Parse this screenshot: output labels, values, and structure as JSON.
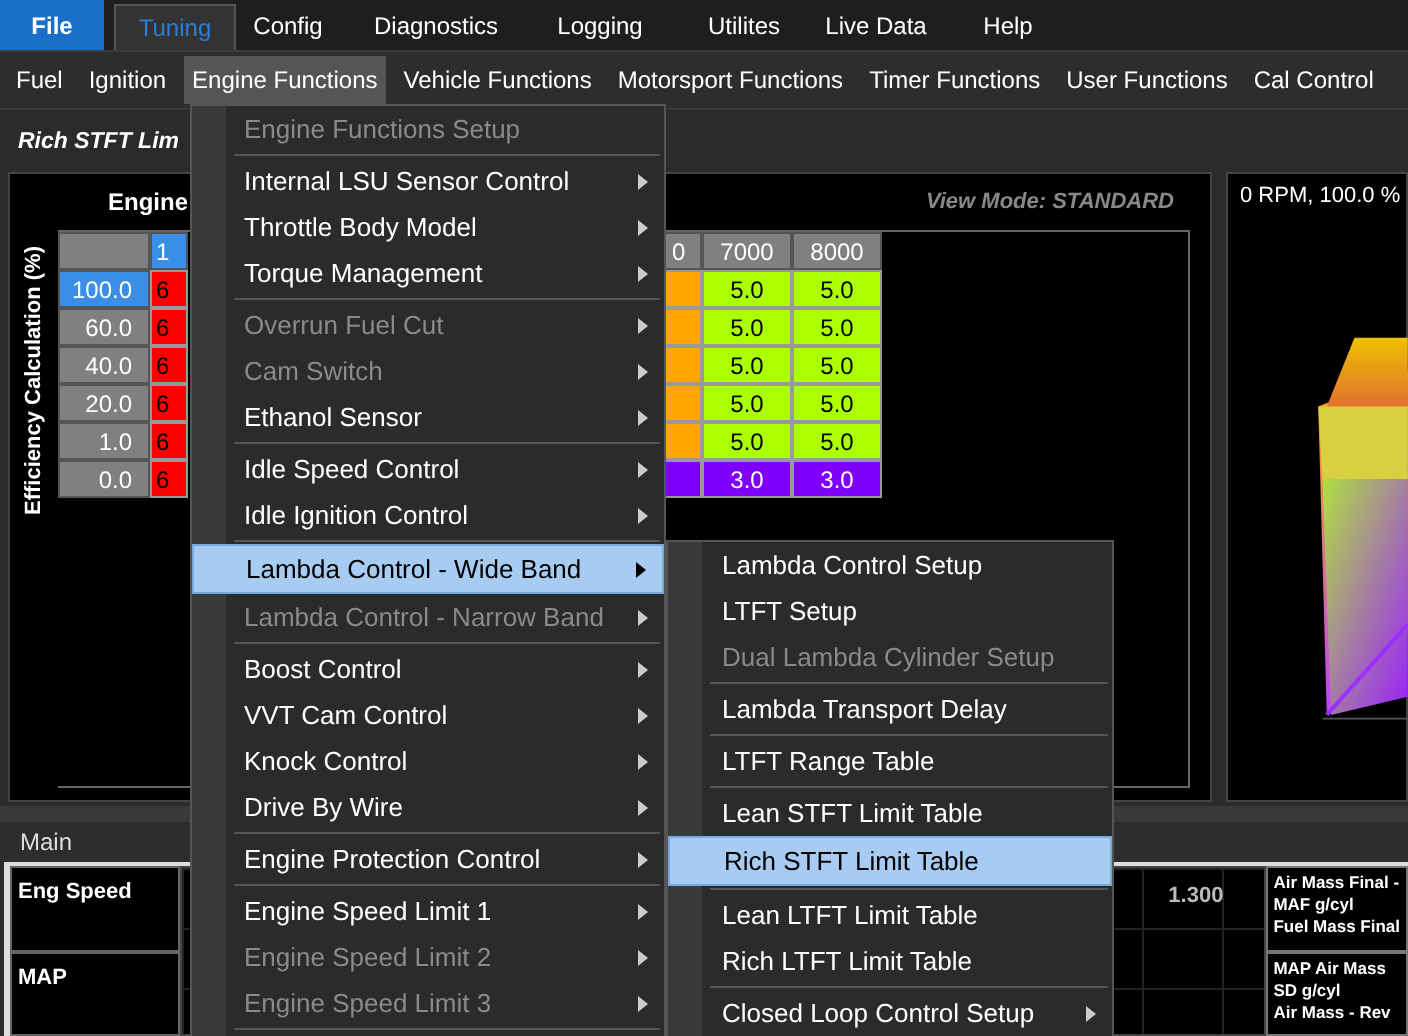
{
  "menubar": [
    {
      "label": "File",
      "kind": "file",
      "selected": false
    },
    {
      "label": "Tuning",
      "kind": "tab",
      "selected": true
    },
    {
      "label": "Config",
      "kind": "tab",
      "selected": false
    },
    {
      "label": "Diagnostics",
      "kind": "tab",
      "selected": false
    },
    {
      "label": "Logging",
      "kind": "tab",
      "selected": false
    },
    {
      "label": "Utilites",
      "kind": "tab",
      "selected": false
    },
    {
      "label": "Live Data",
      "kind": "tab",
      "selected": false
    },
    {
      "label": "Help",
      "kind": "tab",
      "selected": false
    }
  ],
  "toolbar": [
    {
      "label": "Fuel",
      "selected": false
    },
    {
      "label": "Ignition",
      "selected": false
    },
    {
      "label": "Engine Functions",
      "selected": true
    },
    {
      "label": "Vehicle Functions",
      "selected": false
    },
    {
      "label": "Motorsport Functions",
      "selected": false
    },
    {
      "label": "Timer Functions",
      "selected": false
    },
    {
      "label": "User Functions",
      "selected": false
    },
    {
      "label": "Cal Control",
      "selected": false
    }
  ],
  "page_title": "Rich STFT Lim",
  "table": {
    "x_axis_label": "Engine",
    "y_axis_label": "Efficiency Calculation (%)",
    "view_mode": "View Mode: STANDARD",
    "columns": [
      {
        "label": "1",
        "selected": true
      },
      {
        "label": "0",
        "selected": false
      },
      {
        "label": "7000",
        "selected": false
      },
      {
        "label": "8000",
        "selected": false
      }
    ],
    "rows": [
      {
        "label": "100.0",
        "selected": true,
        "cells": [
          {
            "value": "6",
            "color": "#ff0000"
          },
          {
            "color": "#ffa500"
          },
          {
            "value": "5.0",
            "color": "#aaff00"
          },
          {
            "value": "5.0",
            "color": "#aaff00"
          }
        ]
      },
      {
        "label": "60.0",
        "selected": false,
        "cells": [
          {
            "value": "6",
            "color": "#ff0000"
          },
          {
            "color": "#ffa500"
          },
          {
            "value": "5.0",
            "color": "#aaff00"
          },
          {
            "value": "5.0",
            "color": "#aaff00"
          }
        ]
      },
      {
        "label": "40.0",
        "selected": false,
        "cells": [
          {
            "value": "6",
            "color": "#ff0000"
          },
          {
            "color": "#ffa500"
          },
          {
            "value": "5.0",
            "color": "#aaff00"
          },
          {
            "value": "5.0",
            "color": "#aaff00"
          }
        ]
      },
      {
        "label": "20.0",
        "selected": false,
        "cells": [
          {
            "value": "6",
            "color": "#ff0000"
          },
          {
            "color": "#ffa500"
          },
          {
            "value": "5.0",
            "color": "#aaff00"
          },
          {
            "value": "5.0",
            "color": "#aaff00"
          }
        ]
      },
      {
        "label": "1.0",
        "selected": false,
        "cells": [
          {
            "value": "6",
            "color": "#ff0000"
          },
          {
            "color": "#ffa500"
          },
          {
            "value": "5.0",
            "color": "#aaff00"
          },
          {
            "value": "5.0",
            "color": "#aaff00"
          }
        ]
      },
      {
        "label": "0.0",
        "selected": false,
        "cells": [
          {
            "value": "6",
            "color": "#ff0000"
          },
          {
            "color": "#8000ff"
          },
          {
            "value": "3.0",
            "color": "#8000ff"
          },
          {
            "value": "3.0",
            "color": "#8000ff"
          }
        ]
      }
    ]
  },
  "plot_readout": "0 RPM, 100.0 %",
  "bottom": {
    "tab": "Main",
    "gauges": [
      "Eng Speed",
      "MAP"
    ],
    "graph_max": "1.300",
    "info_panels": [
      [
        "Air Mass Final -",
        "MAF g/cyl",
        "Fuel Mass Final"
      ],
      [
        "MAP Air Mass",
        "SD g/cyl",
        "Air Mass - Rev"
      ]
    ]
  },
  "engine_menu": [
    {
      "kind": "item",
      "label": "Engine Functions Setup",
      "disabled": true,
      "submenu": false,
      "selected": false
    },
    {
      "kind": "separator"
    },
    {
      "kind": "item",
      "label": "Internal LSU Sensor Control",
      "disabled": false,
      "submenu": true,
      "selected": false
    },
    {
      "kind": "item",
      "label": "Throttle Body Model",
      "disabled": false,
      "submenu": true,
      "selected": false
    },
    {
      "kind": "item",
      "label": "Torque Management",
      "disabled": false,
      "submenu": true,
      "selected": false
    },
    {
      "kind": "separator"
    },
    {
      "kind": "item",
      "label": "Overrun Fuel Cut",
      "disabled": true,
      "submenu": true,
      "selected": false
    },
    {
      "kind": "item",
      "label": "Cam Switch",
      "disabled": true,
      "submenu": true,
      "selected": false
    },
    {
      "kind": "item",
      "label": "Ethanol Sensor",
      "disabled": false,
      "submenu": true,
      "selected": false
    },
    {
      "kind": "separator"
    },
    {
      "kind": "item",
      "label": "Idle Speed Control",
      "disabled": false,
      "submenu": true,
      "selected": false
    },
    {
      "kind": "item",
      "label": "Idle Ignition Control",
      "disabled": false,
      "submenu": true,
      "selected": false
    },
    {
      "kind": "separator"
    },
    {
      "kind": "item",
      "label": "Lambda Control - Wide Band",
      "disabled": false,
      "submenu": true,
      "selected": true
    },
    {
      "kind": "item",
      "label": "Lambda Control - Narrow Band",
      "disabled": true,
      "submenu": true,
      "selected": false
    },
    {
      "kind": "separator"
    },
    {
      "kind": "item",
      "label": "Boost Control",
      "disabled": false,
      "submenu": true,
      "selected": false
    },
    {
      "kind": "item",
      "label": "VVT Cam Control",
      "disabled": false,
      "submenu": true,
      "selected": false
    },
    {
      "kind": "item",
      "label": "Knock Control",
      "disabled": false,
      "submenu": true,
      "selected": false
    },
    {
      "kind": "item",
      "label": "Drive By Wire",
      "disabled": false,
      "submenu": true,
      "selected": false
    },
    {
      "kind": "separator"
    },
    {
      "kind": "item",
      "label": "Engine Protection Control",
      "disabled": false,
      "submenu": true,
      "selected": false
    },
    {
      "kind": "separator"
    },
    {
      "kind": "item",
      "label": "Engine Speed Limit 1",
      "disabled": false,
      "submenu": true,
      "selected": false
    },
    {
      "kind": "item",
      "label": "Engine Speed Limit 2",
      "disabled": true,
      "submenu": true,
      "selected": false
    },
    {
      "kind": "item",
      "label": "Engine Speed Limit 3",
      "disabled": true,
      "submenu": true,
      "selected": false
    },
    {
      "kind": "separator"
    }
  ],
  "lambda_submenu": [
    {
      "kind": "item",
      "label": "Lambda Control Setup",
      "disabled": false,
      "submenu": false,
      "selected": false
    },
    {
      "kind": "item",
      "label": "LTFT Setup",
      "disabled": false,
      "submenu": false,
      "selected": false
    },
    {
      "kind": "item",
      "label": "Dual Lambda Cylinder Setup",
      "disabled": true,
      "submenu": false,
      "selected": false
    },
    {
      "kind": "separator"
    },
    {
      "kind": "item",
      "label": "Lambda Transport Delay",
      "disabled": false,
      "submenu": false,
      "selected": false
    },
    {
      "kind": "separator"
    },
    {
      "kind": "item",
      "label": "LTFT Range Table",
      "disabled": false,
      "submenu": false,
      "selected": false
    },
    {
      "kind": "separator"
    },
    {
      "kind": "item",
      "label": "Lean STFT Limit Table",
      "disabled": false,
      "submenu": false,
      "selected": false
    },
    {
      "kind": "item",
      "label": "Rich STFT Limit Table",
      "disabled": false,
      "submenu": false,
      "selected": true
    },
    {
      "kind": "separator"
    },
    {
      "kind": "item",
      "label": "Lean LTFT Limit Table",
      "disabled": false,
      "submenu": false,
      "selected": false
    },
    {
      "kind": "item",
      "label": "Rich LTFT Limit Table",
      "disabled": false,
      "submenu": false,
      "selected": false
    },
    {
      "kind": "separator"
    },
    {
      "kind": "item",
      "label": "Closed Loop Control Setup",
      "disabled": false,
      "submenu": true,
      "selected": false
    }
  ]
}
